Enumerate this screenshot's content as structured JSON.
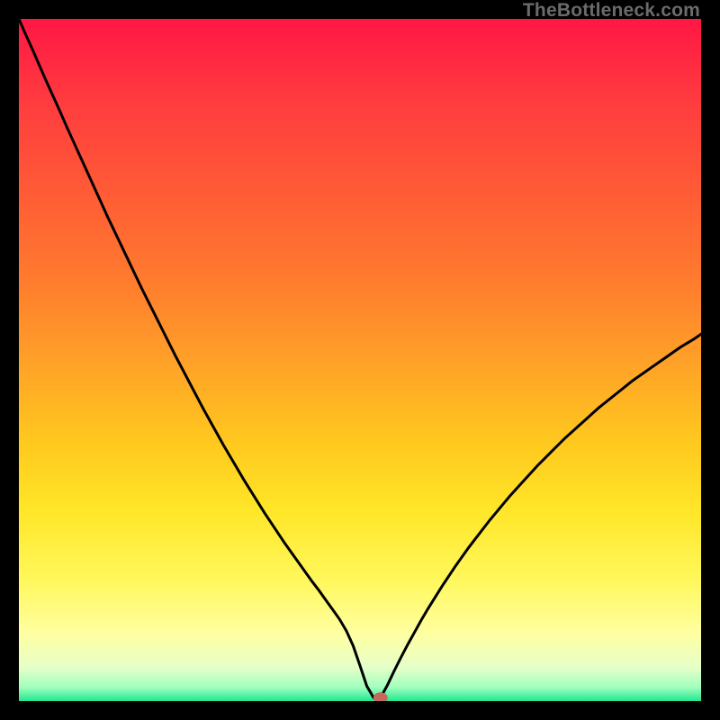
{
  "watermark": "TheBottleneck.com",
  "chart_data": {
    "type": "line",
    "title": "",
    "xlabel": "",
    "ylabel": "",
    "xlim": [
      0,
      100
    ],
    "ylim": [
      0,
      100
    ],
    "x": [
      0,
      1,
      2,
      3,
      4,
      5,
      6,
      7,
      8,
      9,
      10,
      11,
      12,
      13,
      14,
      15,
      16,
      17,
      18,
      19,
      20,
      21,
      22,
      23,
      24,
      25,
      26,
      27,
      28,
      29,
      30,
      31,
      32,
      33,
      34,
      35,
      36,
      37,
      38,
      39,
      40,
      41,
      42,
      43,
      44,
      45,
      46,
      47,
      48,
      49,
      50,
      51,
      52,
      53,
      54,
      55,
      56,
      57,
      58,
      59,
      60,
      61,
      62,
      63,
      64,
      65,
      66,
      67,
      68,
      69,
      70,
      71,
      72,
      73,
      74,
      75,
      76,
      77,
      78,
      79,
      80,
      81,
      82,
      83,
      84,
      85,
      86,
      87,
      88,
      89,
      90,
      91,
      92,
      93,
      94,
      95,
      96,
      97,
      98,
      99,
      100
    ],
    "values": [
      100,
      97.7,
      95.5,
      93.2,
      90.9,
      88.7,
      86.5,
      84.2,
      82.0,
      79.8,
      77.6,
      75.4,
      73.2,
      71.0,
      68.9,
      66.8,
      64.7,
      62.6,
      60.5,
      58.5,
      56.5,
      54.5,
      52.5,
      50.5,
      48.6,
      46.7,
      44.8,
      42.9,
      41.1,
      39.3,
      37.5,
      35.8,
      34.1,
      32.4,
      30.8,
      29.2,
      27.6,
      26.1,
      24.6,
      23.1,
      21.7,
      20.3,
      18.9,
      17.5,
      16.2,
      14.8,
      13.4,
      12.0,
      10.3,
      8.1,
      5.2,
      2.2,
      0.5,
      0.5,
      2.3,
      4.4,
      6.4,
      8.3,
      10.1,
      11.9,
      13.6,
      15.2,
      16.8,
      18.3,
      19.8,
      21.2,
      22.6,
      23.9,
      25.2,
      26.5,
      27.7,
      28.9,
      30.1,
      31.2,
      32.3,
      33.4,
      34.5,
      35.5,
      36.5,
      37.5,
      38.5,
      39.4,
      40.3,
      41.2,
      42.1,
      43.0,
      43.8,
      44.6,
      45.4,
      46.2,
      47.0,
      47.7,
      48.4,
      49.1,
      49.8,
      50.5,
      51.2,
      51.9,
      52.5,
      53.1,
      53.8
    ],
    "marker": {
      "x": 53,
      "y": 0.5
    },
    "gradient_stops": [
      {
        "offset": 0,
        "color": "#ff1744"
      },
      {
        "offset": 12,
        "color": "#ff3b3f"
      },
      {
        "offset": 25,
        "color": "#ff5a36"
      },
      {
        "offset": 38,
        "color": "#ff7a2e"
      },
      {
        "offset": 50,
        "color": "#ffa028"
      },
      {
        "offset": 62,
        "color": "#ffc81e"
      },
      {
        "offset": 72,
        "color": "#ffe628"
      },
      {
        "offset": 82,
        "color": "#fff75a"
      },
      {
        "offset": 90,
        "color": "#ffffa0"
      },
      {
        "offset": 95,
        "color": "#e6ffc8"
      },
      {
        "offset": 98,
        "color": "#a0ffbe"
      },
      {
        "offset": 100,
        "color": "#20e890"
      }
    ]
  }
}
